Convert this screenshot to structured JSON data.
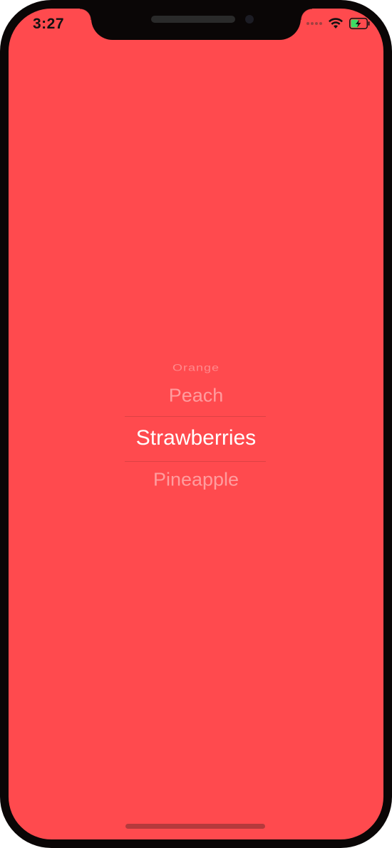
{
  "status_bar": {
    "time": "3:27",
    "icons": [
      "signal-dots-icon",
      "wifi-icon",
      "battery-charging-icon"
    ]
  },
  "screen": {
    "background_color": "#ff4a4e"
  },
  "picker": {
    "items": [
      "Orange",
      "Peach",
      "Strawberries",
      "Pineapple"
    ],
    "selected": "Strawberries",
    "text_color": "#ffffff"
  }
}
